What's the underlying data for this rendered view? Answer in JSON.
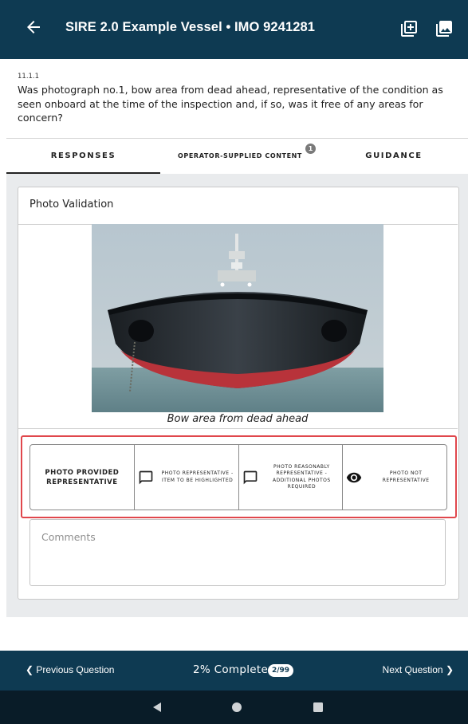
{
  "header": {
    "title": "SIRE 2.0 Example Vessel • IMO 9241281",
    "back_icon": "arrow-left-icon",
    "add_icon": "add-photo-icon",
    "gallery_icon": "gallery-icon"
  },
  "question": {
    "number": "11.1.1",
    "text": "Was photograph no.1, bow area from dead ahead, representative of the condition as seen onboard at the time of the inspection and, if so, was it free of any areas for concern?"
  },
  "tabs": [
    {
      "label": "RESPONSES",
      "active": true
    },
    {
      "label": "OPERATOR-SUPPLIED CONTENT",
      "badge": "1"
    },
    {
      "label": "GUIDANCE"
    }
  ],
  "card": {
    "title": "Photo Validation",
    "caption": "Bow area from dead ahead",
    "responses": [
      {
        "label": "PHOTO PROVIDED REPRESENTATIVE",
        "icon": ""
      },
      {
        "label": "PHOTO REPRESENTATIVE - ITEM TO BE HIGHLIGHTED",
        "icon": "comment-icon"
      },
      {
        "label": "PHOTO REASONABLY REPRESENTATIVE - ADDITIONAL PHOTOS REQUIRED",
        "icon": "comment-icon"
      },
      {
        "label": "PHOTO NOT REPRESENTATIVE",
        "icon": "eye-icon"
      }
    ],
    "comments_placeholder": "Comments"
  },
  "footer": {
    "previous": "Previous Question",
    "progress": "2% Complete",
    "progress_count": "2/99",
    "next": "Next Question"
  },
  "colors": {
    "primary": "#0e3a52",
    "highlight": "#e0474c",
    "hull_red": "#b8333a"
  }
}
